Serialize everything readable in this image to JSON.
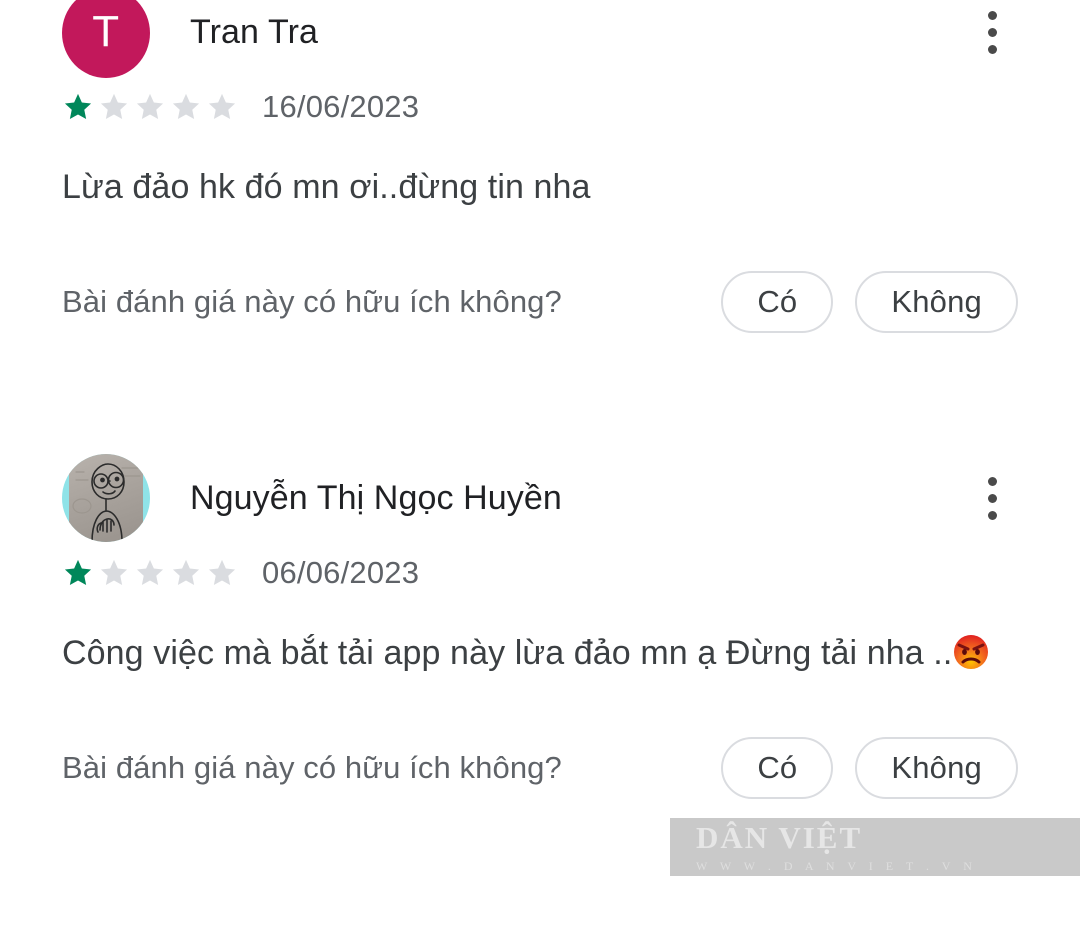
{
  "theme": {
    "background": "#ffffff",
    "text_primary": "#202124",
    "text_secondary": "#5f6368",
    "star_filled": "#00875a",
    "star_empty": "#dadce0",
    "avatar_initial_bg": "#c2185b",
    "button_border": "#dadce0",
    "watermark_band": "#c9c9c9"
  },
  "reviews": [
    {
      "avatar": {
        "type": "initial",
        "initial": "T",
        "icon": "avatar-initial"
      },
      "name": "Tran Tra",
      "rating": 1,
      "rating_max": 5,
      "date": "16/06/2023",
      "text": "Lừa đảo hk đó mn ơi..đừng tin nha",
      "emoji": "",
      "helpful_question": "Bài đánh giá này có hữu ích không?",
      "helpful_yes": "Có",
      "helpful_no": "Không",
      "menu_icon": "more-vert-icon"
    },
    {
      "avatar": {
        "type": "photo",
        "initial": "",
        "icon": "avatar-photo-cartoon"
      },
      "name": "Nguyễn Thị Ngọc Huyền",
      "rating": 1,
      "rating_max": 5,
      "date": "06/06/2023",
      "text": "Công việc mà bắt tải app này lừa đảo mn ạ Đừng tải nha ..",
      "emoji": "😡",
      "helpful_question": "Bài đánh giá này có hữu ích không?",
      "helpful_yes": "Có",
      "helpful_no": "Không",
      "menu_icon": "more-vert-icon"
    }
  ],
  "watermark": {
    "title": "DÂN VIỆT",
    "subtitle": "W W W . D A N V I E T . V N"
  }
}
